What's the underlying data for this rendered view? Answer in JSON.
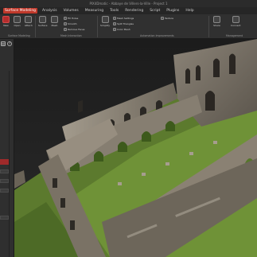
{
  "window": {
    "title": "PIX4Dmatic - Abbaye de Villers-la-Ville - Project 1"
  },
  "menu": {
    "items": [
      "Surface Modeling",
      "Analysis",
      "Volumes",
      "Measuring",
      "Tools",
      "Rendering",
      "Script",
      "Plugins",
      "Help"
    ]
  },
  "ribbon": {
    "buttons": {
      "new": "New",
      "open": "Open",
      "attach": "Attach",
      "surface": "Surface",
      "mesh": "Mesh",
      "simplify": "Simplify",
      "share": "Share",
      "connect": "Connect"
    },
    "small": {
      "fill_holes": "Fill Holes",
      "smooth": "Smooth",
      "remove_faces": "Remove Faces",
      "mesh_settings": "Mesh Settings",
      "split": "Split Triangles",
      "color": "Color Mesh",
      "texture": "Texture"
    },
    "groups": [
      "Surface Modeling",
      "Mesh Interaction",
      "Automation Improvements",
      "Management"
    ]
  }
}
